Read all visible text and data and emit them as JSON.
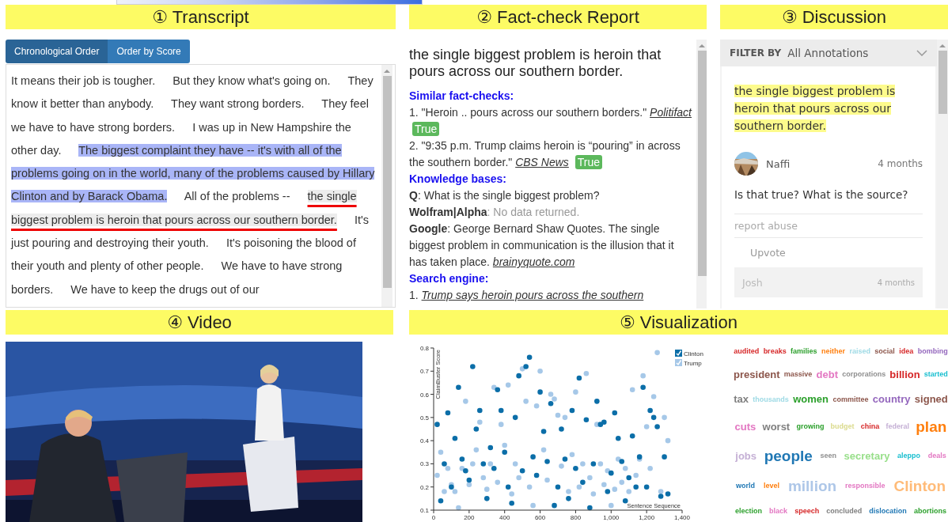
{
  "panels": [
    {
      "label": "① Transcript"
    },
    {
      "label": "② Fact-check Report"
    },
    {
      "label": "③ Discussion"
    },
    {
      "label": "④ Video"
    },
    {
      "label": "⑤ Visualization"
    }
  ],
  "transcript": {
    "tabs": [
      {
        "label": "Chronological Order",
        "selected": true
      },
      {
        "label": "Order by Score",
        "selected": false
      }
    ],
    "sentences": [
      {
        "text": "It means their job is tougher.",
        "kind": "plain"
      },
      {
        "text": "But they know what's going on.",
        "kind": "plain"
      },
      {
        "text": "They know it better than anybody.",
        "kind": "plain"
      },
      {
        "text": "They want strong borders.",
        "kind": "plain"
      },
      {
        "text": "They feel we have to have strong borders.",
        "kind": "plain"
      },
      {
        "text": "I was up in New Hampshire the other day.",
        "kind": "plain"
      },
      {
        "text": "The biggest complaint they have -- it's with all of the problems going on in the world, many of the problems caused by Hillary Clinton and by Barack Obama.",
        "kind": "highlighted"
      },
      {
        "text": "All of the problems --",
        "kind": "plain"
      },
      {
        "text": "the single biggest problem is heroin that pours across our southern border.",
        "kind": "selected"
      },
      {
        "text": "It's just pouring and destroying their youth.",
        "kind": "plain"
      },
      {
        "text": "It's poisoning the blood of their youth and plenty of other people.",
        "kind": "plain"
      },
      {
        "text": "We have to have strong borders.",
        "kind": "plain"
      },
      {
        "text": "We have to keep the drugs out of our",
        "kind": "plain"
      }
    ]
  },
  "fact_check": {
    "claim": "the single biggest problem is heroin that pours across our southern border.",
    "sections": [
      {
        "heading": "Similar fact-checks:",
        "kind": "fact_checks",
        "items": [
          {
            "quote": "1. \"Heroin .. pours across our southern borders.\"",
            "source": "Politifact",
            "verdict": "True"
          },
          {
            "quote": "2. \"9:35 p.m. Trump claims heroin is “pouring” in across the southern border.\"",
            "source": "CBS News",
            "verdict": "True"
          }
        ]
      },
      {
        "heading": "Knowledge bases:",
        "kind": "knowledge",
        "items": [
          {
            "text": "**Q**: What is the single biggest problem?",
            "muted": false
          },
          {
            "text": "**Wolfram|Alpha**: No data returned.",
            "muted": true
          },
          {
            "text": "**Google**: George Bernard Shaw Quotes. The single biggest problem in communication is the illusion that it has taken place.",
            "muted": false,
            "link": "brainyquote.com"
          }
        ]
      },
      {
        "heading": "Search engine:",
        "kind": "search",
        "items": [
          {
            "number": "1.",
            "link": "Trump says heroin pours across the southern"
          }
        ]
      }
    ]
  },
  "discussion": {
    "filter_label": "FILTER BY",
    "filter_value": "All Annotations",
    "quote": "the single biggest problem is heroin that pours across our southern border.",
    "comments": [
      {
        "user": "Naffi",
        "time": "4 months",
        "text": "Is that true? What is the source?",
        "report": "report abuse",
        "upvote": "Upvote",
        "faded": false
      },
      {
        "user": "Josh",
        "time": "4 months",
        "faded": true
      }
    ]
  },
  "visualization": {
    "chart_data": {
      "type": "scatter",
      "xlabel": "Sentence Sequence",
      "ylabel": "ClaimBuster Score",
      "legend": true,
      "xlim": [
        0,
        1400
      ],
      "ylim": [
        0.1,
        0.8
      ],
      "xticks": [
        0,
        200,
        400,
        600,
        800,
        {
          "value": 1000,
          "label": "1,000"
        },
        {
          "value": 1200,
          "label": "1,200"
        },
        {
          "value": 1400,
          "label": "1,400"
        }
      ],
      "x": [
        20,
        40,
        60,
        80,
        100,
        120,
        140,
        160,
        180,
        200,
        220,
        240,
        260,
        280,
        300,
        320,
        340,
        360,
        380,
        400,
        420,
        440,
        460,
        480,
        500,
        520,
        540,
        560,
        580,
        600,
        620,
        640,
        660,
        680,
        700,
        720,
        740,
        760,
        780,
        800,
        820,
        840,
        860,
        880,
        900,
        920,
        940,
        960,
        980,
        1000,
        1020,
        1040,
        1060,
        1080,
        1100,
        1120,
        1140,
        1160,
        1180,
        1200,
        1220,
        1240,
        1260,
        1280,
        1300,
        1320
      ],
      "yticks": [
        0.1,
        0.2,
        0.3,
        0.4,
        0.5,
        0.6,
        0.7,
        0.8
      ],
      "series": [
        {
          "name": "Trump",
          "color": "#a6c8e8",
          "values": [
            0.25,
            0.35,
            0.18,
            0.28,
            0.21,
            0.18,
            0.11,
            0.28,
            0.57,
            0.21,
            0.3,
            0.36,
            0.48,
            0.24,
            0.19,
            0.3,
            0.63,
            0.22,
            0.47,
            0.38,
            0.64,
            0.17,
            0.3,
            0.24,
            0.71,
            0.57,
            0.2,
            0.12,
            0.55,
            0.7,
            0.36,
            0.23,
            0.6,
            0.58,
            0.51,
            0.29,
            0.5,
            0.18,
            0.34,
            0.61,
            0.2,
            0.3,
            0.69,
            0.24,
            0.17,
            0.47,
            0.3,
            0.21,
            0.27,
            0.12,
            0.19,
            0.32,
            0.22,
            0.28,
            0.18,
            0.62,
            0.25,
            0.32,
            0.68,
            0.46,
            0.28,
            0.59,
            0.78,
            0.18,
            0.5,
            0.4
          ]
        },
        {
          "name": "Clinton",
          "color": "#0b6ea8",
          "values": [
            0.47,
            0.14,
            0.3,
            0.52,
            0.2,
            0.41,
            0.63,
            0.32,
            0.27,
            0.23,
            0.72,
            0.45,
            0.53,
            0.3,
            0.15,
            0.37,
            0.28,
            0.62,
            0.53,
            0.35,
            0.2,
            0.13,
            0.5,
            0.68,
            0.27,
            0.72,
            0.76,
            0.33,
            0.25,
            0.61,
            0.44,
            0.31,
            0.56,
            0.12,
            0.2,
            0.45,
            0.32,
            0.15,
            0.53,
            0.28,
            0.67,
            0.22,
            0.49,
            0.11,
            0.3,
            0.57,
            0.47,
            0.48,
            0.18,
            0.26,
            0.52,
            0.41,
            0.31,
            0.14,
            0.24,
            0.42,
            0.2,
            0.33,
            0.63,
            0.2,
            0.53,
            0.5,
            0.46,
            0.16,
            0.33,
            0.17
          ]
        }
      ]
    },
    "word_cloud": [
      {
        "text": "audited",
        "color": "#d62728",
        "kind": "small"
      },
      {
        "text": "breaks",
        "color": "#d62728",
        "kind": "small"
      },
      {
        "text": "families",
        "color": "#2ca02c",
        "kind": "small"
      },
      {
        "text": "neither",
        "color": "#ff7f0e",
        "kind": "small"
      },
      {
        "text": "raised",
        "color": "#9edae5",
        "kind": "small"
      },
      {
        "text": "social",
        "color": "#8c564b",
        "kind": "small"
      },
      {
        "text": "idea",
        "color": "#d62728",
        "kind": "small"
      },
      {
        "text": "bombing",
        "color": "#9467bd",
        "kind": "small"
      },
      {
        "text": "president",
        "color": "#8c564b",
        "kind": "medium"
      },
      {
        "text": "massive",
        "color": "#8c564b",
        "kind": "small"
      },
      {
        "text": "debt",
        "color": "#e377c2",
        "kind": "medium"
      },
      {
        "text": "corporations",
        "color": "#8f8f8f",
        "kind": "small"
      },
      {
        "text": "billion",
        "color": "#d62728",
        "kind": "medium"
      },
      {
        "text": "started",
        "color": "#17becf",
        "kind": "small"
      },
      {
        "text": "tax",
        "color": "#7f7f7f",
        "kind": "medium"
      },
      {
        "text": "thousands",
        "color": "#9edae5",
        "kind": "small"
      },
      {
        "text": "women",
        "color": "#2ca02c",
        "kind": "medium"
      },
      {
        "text": "committee",
        "color": "#8c564b",
        "kind": "small"
      },
      {
        "text": "country",
        "color": "#9467bd",
        "kind": "medium"
      },
      {
        "text": "signed",
        "color": "#8c564b",
        "kind": "medium"
      },
      {
        "text": "cuts",
        "color": "#e377c2",
        "kind": "medium"
      },
      {
        "text": "worst",
        "color": "#7f7f7f",
        "kind": "medium"
      },
      {
        "text": "growing",
        "color": "#2ca02c",
        "kind": "small"
      },
      {
        "text": "budget",
        "color": "#dbdb8d",
        "kind": "small"
      },
      {
        "text": "china",
        "color": "#d62728",
        "kind": "small"
      },
      {
        "text": "federal",
        "color": "#c5b0d5",
        "kind": "small"
      },
      {
        "text": "plan",
        "color": "#ff7f0e",
        "kind": "large"
      },
      {
        "text": "jobs",
        "color": "#c5b0d5",
        "kind": "medium"
      },
      {
        "text": "people",
        "color": "#1f77b4",
        "kind": "large"
      },
      {
        "text": "seen",
        "color": "#8f8f8f",
        "kind": "small"
      },
      {
        "text": "secretary",
        "color": "#98df8a",
        "kind": "medium"
      },
      {
        "text": "aleppo",
        "color": "#17becf",
        "kind": "small"
      },
      {
        "text": "deals",
        "color": "#e377c2",
        "kind": "small"
      },
      {
        "text": "world",
        "color": "#1f77b4",
        "kind": "small"
      },
      {
        "text": "level",
        "color": "#ff7f0e",
        "kind": "small"
      },
      {
        "text": "million",
        "color": "#aec7e8",
        "kind": "large"
      },
      {
        "text": "responsible",
        "color": "#e377c2",
        "kind": "small"
      },
      {
        "text": "Clinton",
        "color": "#ffbb78",
        "kind": "large"
      },
      {
        "text": "election",
        "color": "#2ca02c",
        "kind": "small"
      },
      {
        "text": "black",
        "color": "#e377c2",
        "kind": "small"
      },
      {
        "text": "speech",
        "color": "#d62728",
        "kind": "small"
      },
      {
        "text": "concluded",
        "color": "#7f7f7f",
        "kind": "small"
      },
      {
        "text": "dislocation",
        "color": "#1f77b4",
        "kind": "small"
      },
      {
        "text": "abortions",
        "color": "#2ca02c",
        "kind": "small"
      }
    ]
  }
}
